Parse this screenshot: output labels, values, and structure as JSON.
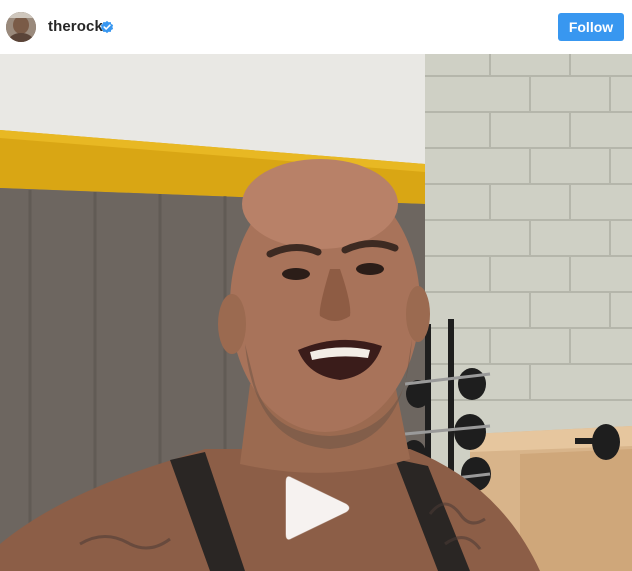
{
  "post": {
    "username": "therock",
    "verified": true,
    "follow_label": "Follow"
  },
  "icons": {
    "avatar": "profile-avatar",
    "verified": "verified-badge-icon",
    "play": "play-icon"
  },
  "colors": {
    "follow_button": "#3897f0",
    "verified_badge": "#3897f0",
    "username_text": "#262626"
  }
}
